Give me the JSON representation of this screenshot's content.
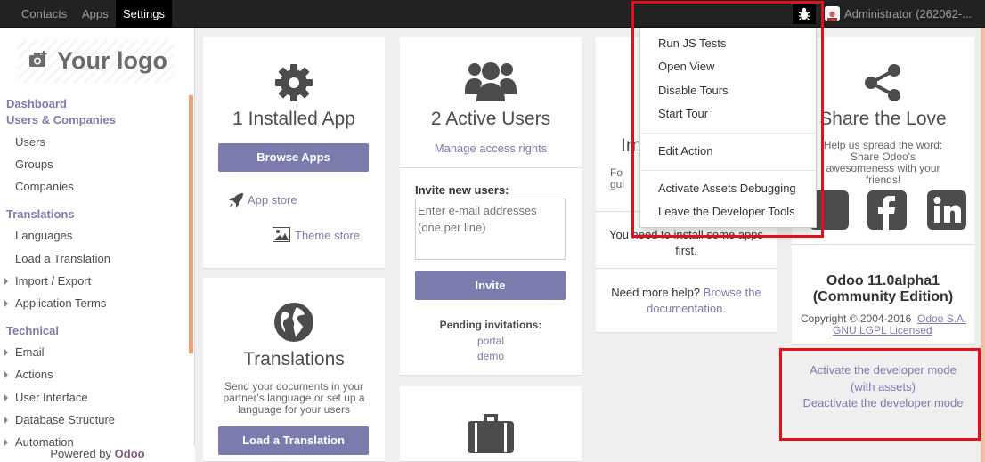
{
  "nav": {
    "items": [
      "Contacts",
      "Apps",
      "Settings"
    ],
    "user": "Administrator (262062-..."
  },
  "sidebar": {
    "logo": "Your logo",
    "section1": "Dashboard",
    "section2": "Users & Companies",
    "users_items": [
      "Users",
      "Groups",
      "Companies"
    ],
    "section3": "Translations",
    "translations_items": [
      "Languages",
      "Load a Translation",
      "Import / Export",
      "Application Terms"
    ],
    "section4": "Technical",
    "technical_items": [
      "Email",
      "Actions",
      "User Interface",
      "Database Structure",
      "Automation"
    ],
    "powered_prefix": "Powered by",
    "powered_brand": "Odoo"
  },
  "apps_card": {
    "title": "1 Installed App",
    "button": "Browse Apps",
    "app_store": "App store",
    "theme_store": "Theme store"
  },
  "users_card": {
    "title": "2 Active Users",
    "manage": "Manage access rights",
    "invite_label": "Invite new users:",
    "invite_placeholder": "Enter e-mail addresses (one per line)",
    "invite_button": "Invite",
    "pending_label": "Pending invitations:",
    "pending": [
      "portal",
      "demo"
    ]
  },
  "translations_card": {
    "title": "Translations",
    "desc": "Send your documents in your partner's language or set up a language for your users",
    "button": "Load a Translation"
  },
  "import_card": {
    "title_partial": "Im",
    "desc_partial": "Fo\ngui",
    "need_install": "You need to install some apps first.",
    "help_prefix": "Need more help?",
    "help_link": "Browse the documentation."
  },
  "share_card": {
    "title": "Share the Love",
    "desc": "Help us spread the word: Share Odoo's awesomeness with your friends!",
    "version": "Odoo 11.0alpha1",
    "edition": "(Community Edition)",
    "copyright": "Copyright © 2004-2016",
    "company": "Odoo S.A.",
    "license": "GNU LGPL Licensed",
    "dev_mode_assets": "Activate the developer mode (with assets)",
    "dev_mode_deactivate": "Deactivate the developer mode"
  },
  "debug_menu": {
    "items_group1": [
      "Run JS Tests",
      "Open View",
      "Disable Tours",
      "Start Tour"
    ],
    "items_group2": [
      "Edit Action"
    ],
    "items_group3": [
      "Activate Assets Debugging",
      "Leave the Developer Tools"
    ]
  },
  "colors": {
    "brand": "#7c7bad",
    "navbar": "#222222",
    "highlight": "#e0111b",
    "accent": "#f0a07c"
  },
  "icons": [
    "bug-icon",
    "camera-icon",
    "gear-icon",
    "users-icon",
    "rocket-icon",
    "image-icon",
    "globe-icon",
    "briefcase-icon",
    "share-icon",
    "twitter-icon",
    "facebook-icon",
    "linkedin-icon"
  ]
}
